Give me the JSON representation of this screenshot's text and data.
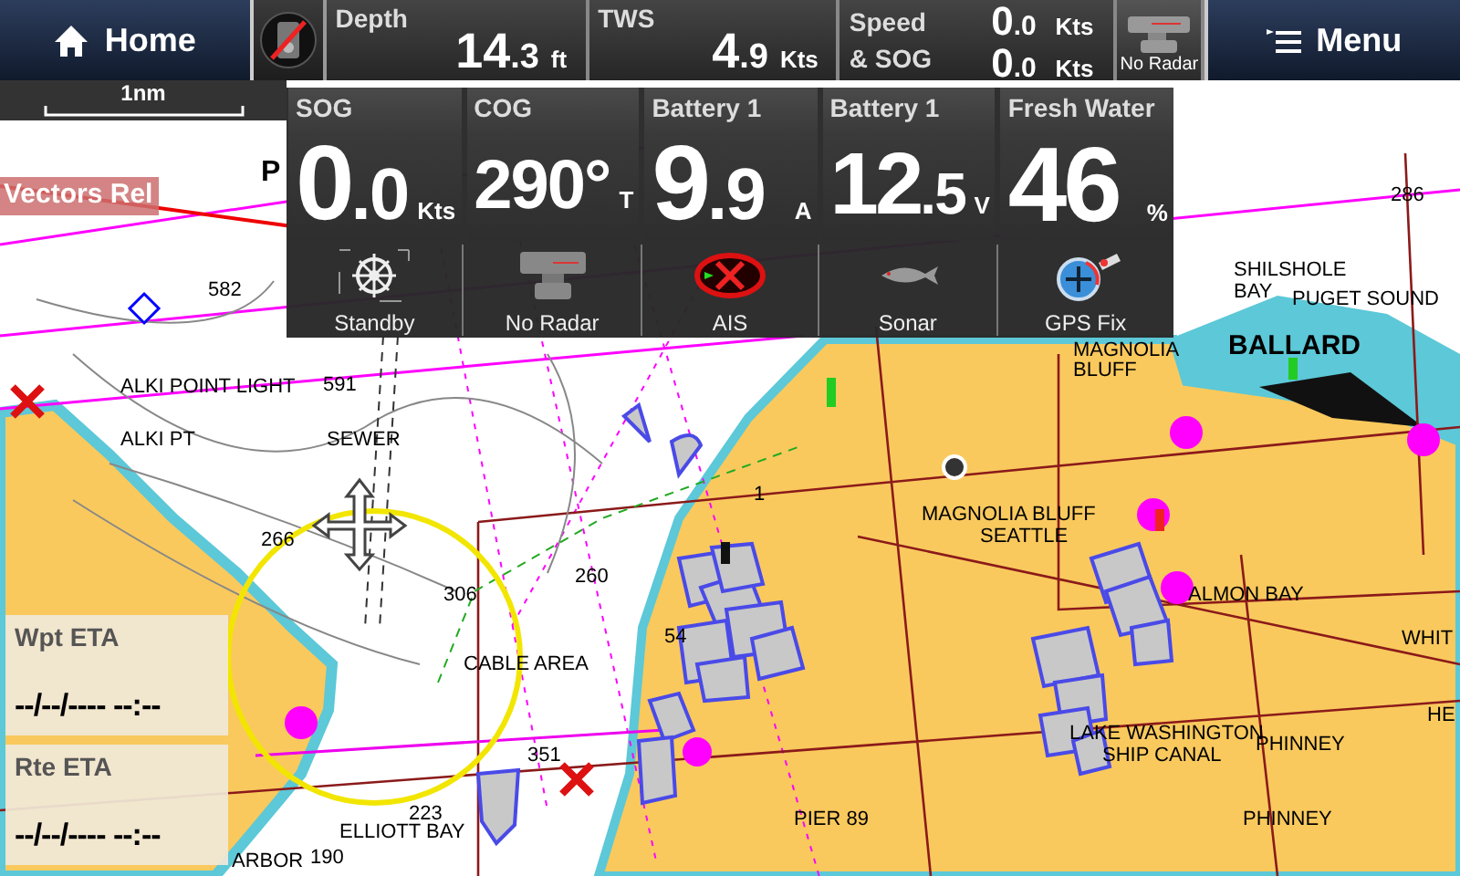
{
  "top_bar": {
    "home": {
      "label": "Home"
    },
    "readouts": [
      {
        "label": "Depth",
        "whole": "14",
        "fraction": ".3",
        "unit": "ft"
      },
      {
        "label": "TWS",
        "whole": "4",
        "fraction": ".9",
        "unit": "Kts"
      }
    ],
    "speed_sog": {
      "labels": [
        "Speed",
        "& SOG"
      ],
      "values": [
        {
          "whole": "0",
          "fraction": ".0",
          "unit": "Kts"
        },
        {
          "whole": "0",
          "fraction": ".0",
          "unit": "Kts"
        }
      ]
    },
    "radar": {
      "label": "No Radar"
    },
    "menu": {
      "label": "Menu"
    }
  },
  "scale": {
    "label": "1nm"
  },
  "vectors_badge": {
    "label": "Vectors Rel"
  },
  "data_panel": {
    "tiles": [
      {
        "label": "SOG",
        "whole": "0",
        "fraction": ".0",
        "unit": "Kts"
      },
      {
        "label": "COG",
        "whole": "290°",
        "unit": "T"
      },
      {
        "label": "Battery 1",
        "whole": "9",
        "fraction": ".9",
        "unit": "A"
      },
      {
        "label": "Battery 1",
        "whole": "12",
        "fraction": ".5",
        "unit": "V"
      },
      {
        "label": "Fresh Water",
        "whole": "46",
        "unit": "%"
      }
    ],
    "status": [
      {
        "kind": "pilot",
        "label": "Standby"
      },
      {
        "kind": "radar",
        "label": "No Radar"
      },
      {
        "kind": "ais",
        "label": "AIS"
      },
      {
        "kind": "sonar",
        "label": "Sonar"
      },
      {
        "kind": "gps",
        "label": "GPS Fix"
      }
    ]
  },
  "map": {
    "labels": [
      {
        "text": "P"
      },
      {
        "text": "582"
      },
      {
        "text": "ALKI POINT LIGHT"
      },
      {
        "text": "591"
      },
      {
        "text": "ALKI PT"
      },
      {
        "text": "SEWER"
      },
      {
        "text": "266"
      },
      {
        "text": "306"
      },
      {
        "text": "260"
      },
      {
        "text": "CABLE AREA"
      },
      {
        "text": "54"
      },
      {
        "text": "351"
      },
      {
        "text": "223"
      },
      {
        "text": "ELLIOTT BAY"
      },
      {
        "text": "190"
      },
      {
        "text": "ARBOR"
      },
      {
        "text": "286"
      },
      {
        "text": "SHILSHOLE"
      },
      {
        "text": "BAY"
      },
      {
        "text": "PUGET SOUND"
      },
      {
        "text": "BALLARD"
      },
      {
        "text": "MAGNOLIA"
      },
      {
        "text": "BLUFF"
      },
      {
        "text": "MAGNOLIA BLUFF"
      },
      {
        "text": "SEATTLE"
      },
      {
        "text": "ALMON BAY"
      },
      {
        "text": "WHIT"
      },
      {
        "text": "LAKE WASHINGTON"
      },
      {
        "text": "SHIP CANAL"
      },
      {
        "text": "PHINNEY"
      },
      {
        "text": "PIER 89"
      },
      {
        "text": "PHINNEY"
      },
      {
        "text": "HE"
      },
      {
        "text": "1"
      }
    ]
  },
  "eta_boxes": [
    {
      "label": "Wpt ETA",
      "value": "--/--/---- --:--"
    },
    {
      "label": "Rte ETA",
      "value": "--/--/---- --:--"
    }
  ]
}
